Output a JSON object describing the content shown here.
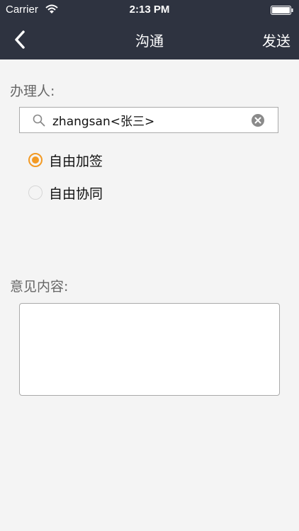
{
  "status_bar": {
    "carrier": "Carrier",
    "time": "2:13 PM",
    "wifi_icon": "wifi-icon",
    "battery_icon": "battery-icon"
  },
  "nav": {
    "title": "沟通",
    "send_label": "发送",
    "back_icon": "chevron-left-icon"
  },
  "form": {
    "assignee_label": "办理人:",
    "search_value": "zhangsan<张三>",
    "search_icon": "search-icon",
    "clear_icon": "clear-icon",
    "options": [
      {
        "label": "自由加签",
        "selected": true
      },
      {
        "label": "自由协同",
        "selected": false
      }
    ],
    "opinion_label": "意见内容:",
    "opinion_value": ""
  },
  "colors": {
    "header_bg": "#2e3340",
    "accent": "#f39a24",
    "page_bg": "#f4f4f4"
  }
}
